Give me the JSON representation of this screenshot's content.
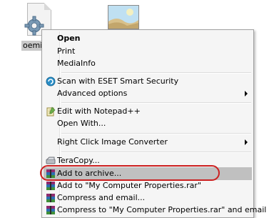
{
  "desktop": {
    "file_label": "oemin",
    "file_icon": "settings-file-icon",
    "image_icon": "image-file-icon"
  },
  "context_menu": {
    "items": [
      {
        "label": "Open",
        "bold": true
      },
      {
        "label": "Print"
      },
      {
        "label": "MediaInfo"
      },
      {
        "label": "Scan with ESET Smart Security",
        "icon": "eset-icon"
      },
      {
        "label": "Advanced options",
        "submenu": true
      },
      {
        "label": "Edit with Notepad++",
        "icon": "notepad-plus-plus-icon"
      },
      {
        "label": "Open With..."
      },
      {
        "label": "Right Click Image Converter",
        "submenu": true
      },
      {
        "label": "TeraCopy...",
        "icon": "teracopy-icon"
      },
      {
        "label": "Add to archive...",
        "icon": "winrar-icon",
        "highlighted": true
      },
      {
        "label": "Add to \"My Computer Properties.rar\"",
        "icon": "winrar-icon"
      },
      {
        "label": "Compress and email...",
        "icon": "winrar-icon"
      },
      {
        "label": "Compress to \"My Computer Properties.rar\" and email",
        "icon": "winrar-icon"
      }
    ]
  },
  "colors": {
    "highlight": "#c0c0c0",
    "annotation": "#cc2020"
  }
}
